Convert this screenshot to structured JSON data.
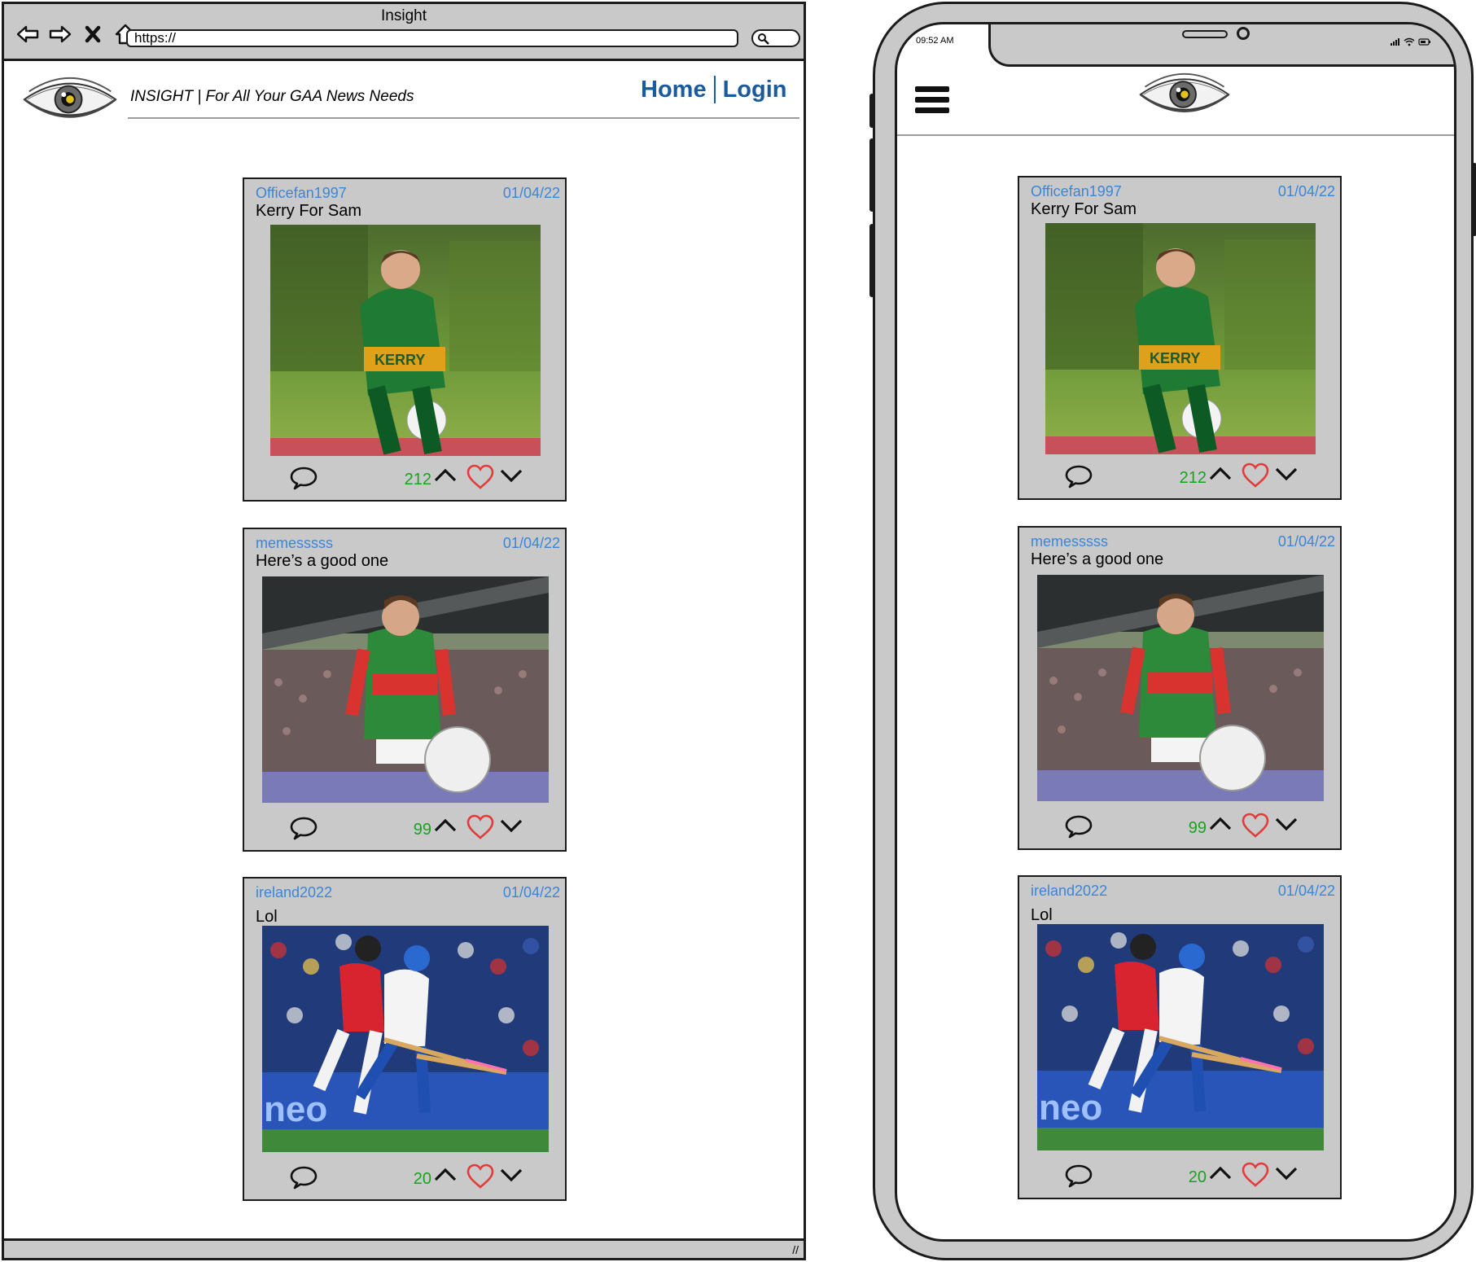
{
  "browser": {
    "window_title": "Insight",
    "url": "https://",
    "nav_icons": [
      "back-icon",
      "forward-icon",
      "close-icon",
      "home-icon"
    ]
  },
  "site": {
    "tagline": "INSIGHT | For All Your GAA News Needs",
    "logo_icon": "eye-icon",
    "nav": {
      "home": "Home",
      "login": "Login"
    },
    "accent_color": "#1a5b9e",
    "username_color": "#3a86d8",
    "vote_color": "#1aa122",
    "heart_color": "#e23b3b"
  },
  "posts": [
    {
      "user": "Officefan1997",
      "date": "01/04/22",
      "title": "Kerry For Sam",
      "votes": "212",
      "image": "Kerry footballer in green and gold jersey carrying a ball"
    },
    {
      "user": "memesssss",
      "date": "01/04/22",
      "title": "Here’s a good one",
      "votes": "99",
      "image": "Mayo footballer in green and red jersey running toward a ball in a stadium"
    },
    {
      "user": "ireland2022",
      "date": "01/04/22",
      "title": "Lol",
      "votes": "20",
      "image": "Two hurlers in red and white jerseys contesting with hurleys"
    }
  ],
  "phone": {
    "time": "09:52 AM",
    "status_icons": [
      "signal-icon",
      "wifi-icon",
      "battery-icon"
    ],
    "menu_icon": "hamburger-menu-icon"
  },
  "card_icons": [
    "comment-icon",
    "upvote-chevron-icon",
    "heart-icon",
    "downvote-chevron-icon"
  ]
}
